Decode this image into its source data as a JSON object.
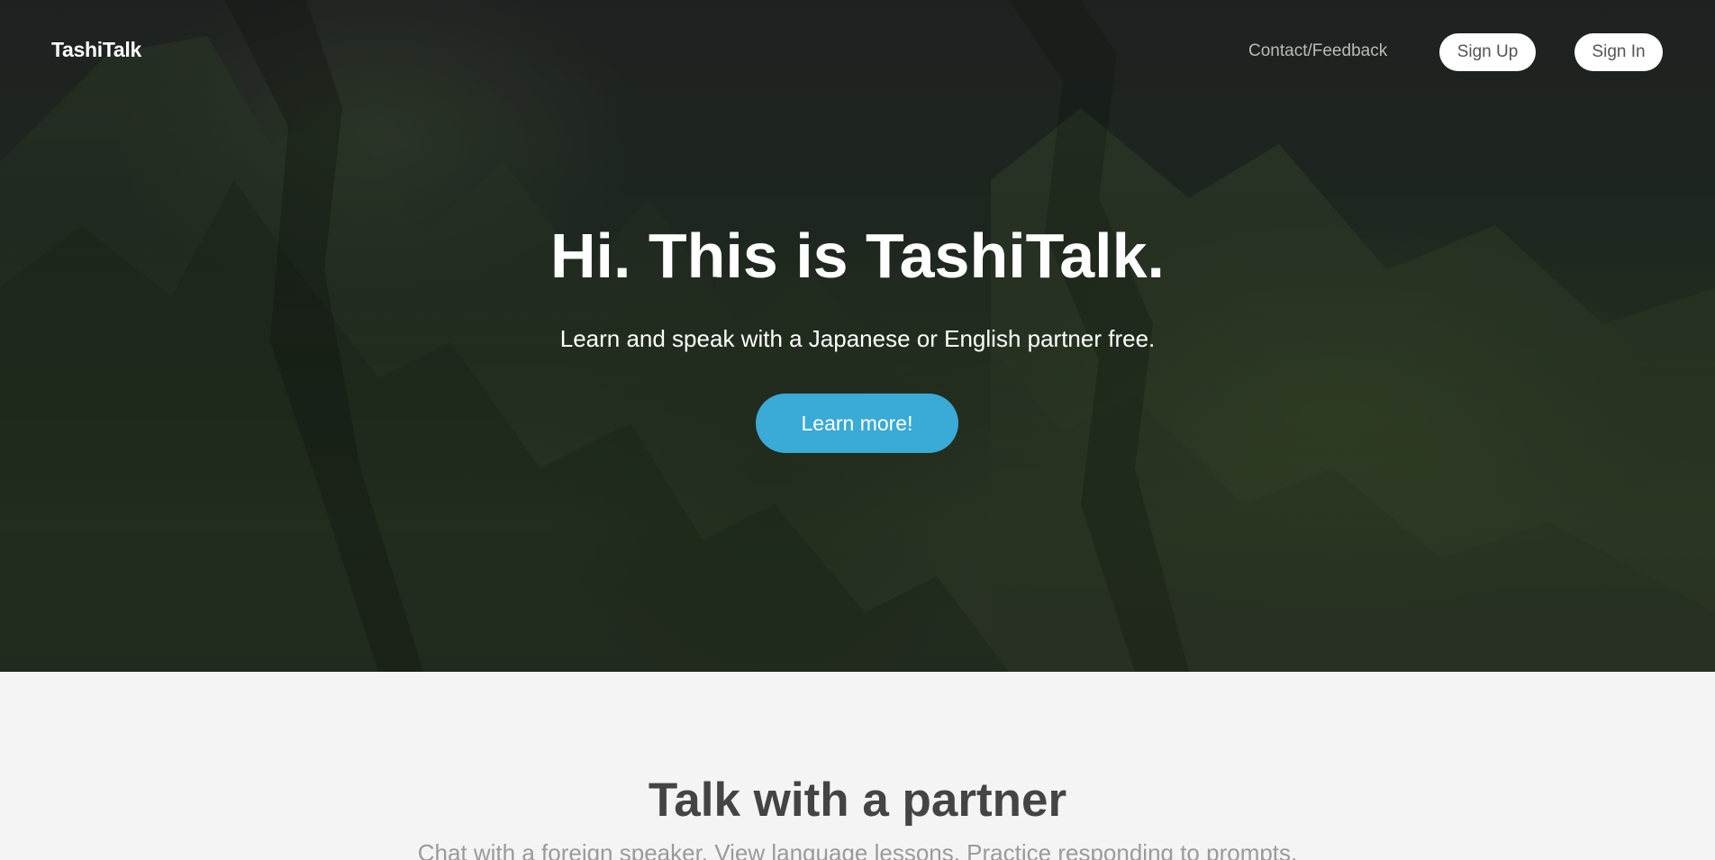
{
  "nav": {
    "brand": "TashiTalk",
    "contact_link": "Contact/Feedback",
    "signup_label": "Sign Up",
    "signin_label": "Sign In"
  },
  "hero": {
    "title": "Hi. This is TashiTalk.",
    "subtitle": "Learn and speak with a Japanese or English partner free.",
    "cta_label": "Learn more!",
    "background_image": "forested-mountains"
  },
  "features": {
    "title": "Talk with a partner",
    "subtitle": "Chat with a foreign speaker. View language lessons. Practice responding to prompts."
  },
  "colors": {
    "accent": "#3aaad6",
    "section_background": "#f4f4f4",
    "heading_dark": "#444444"
  }
}
